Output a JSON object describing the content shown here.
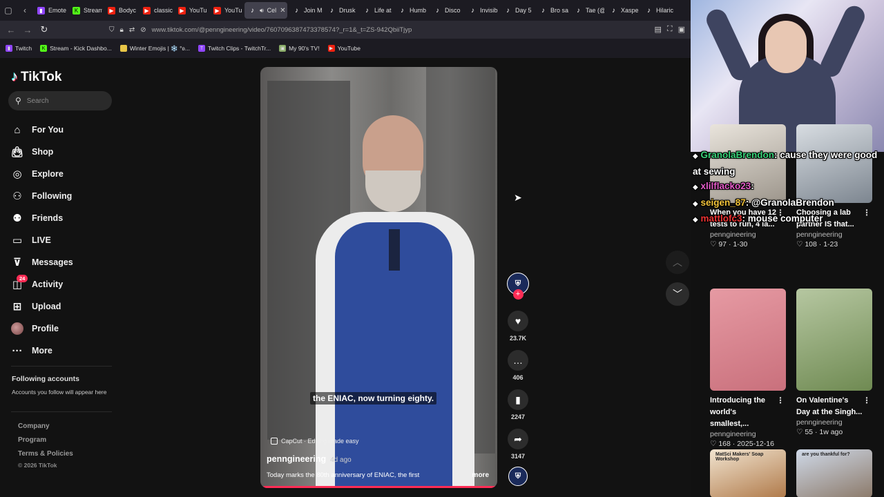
{
  "browser": {
    "tabs": [
      {
        "label": "Emote",
        "icon": "twitch"
      },
      {
        "label": "Stream",
        "icon": "kick"
      },
      {
        "label": "Bodyc",
        "icon": "youtube"
      },
      {
        "label": "classic",
        "icon": "youtube"
      },
      {
        "label": "YouTu",
        "icon": "youtube"
      },
      {
        "label": "YouTu",
        "icon": "youtube"
      },
      {
        "label": "Cel",
        "icon": "tiktok",
        "active": true
      },
      {
        "label": "Join M",
        "icon": "tiktok"
      },
      {
        "label": "Drusk",
        "icon": "tiktok"
      },
      {
        "label": "Life at",
        "icon": "tiktok"
      },
      {
        "label": "Humb",
        "icon": "tiktok"
      },
      {
        "label": "Disco",
        "icon": "tiktok"
      },
      {
        "label": "Invisib",
        "icon": "tiktok"
      },
      {
        "label": "Day 5",
        "icon": "tiktok"
      },
      {
        "label": "Bro sa",
        "icon": "tiktok"
      },
      {
        "label": "Tae (@",
        "icon": "tiktok"
      },
      {
        "label": "Xaspe",
        "icon": "tiktok"
      },
      {
        "label": "Hilaric",
        "icon": "tiktok"
      }
    ],
    "url": "www.tiktok.com/@penngineering/video/7607096387473378574?_r=1&_t=ZS-942QbiiTjyp",
    "bookmarks": [
      {
        "label": "Twitch",
        "icon": "twitch"
      },
      {
        "label": "Stream - Kick Dashbo...",
        "icon": "kick"
      },
      {
        "label": "Winter Emojis | ❄️ °ʚ...",
        "icon": "folder"
      },
      {
        "label": "Twitch Clips - TwitchTr...",
        "icon": "tt"
      },
      {
        "label": "My 90's TV!",
        "icon": "tv"
      },
      {
        "label": "YouTube",
        "icon": "youtube"
      }
    ]
  },
  "sidebar": {
    "logo": "TikTok",
    "search_placeholder": "Search",
    "items": [
      {
        "label": "For You",
        "icon": "home-icon"
      },
      {
        "label": "Shop",
        "icon": "shop-icon"
      },
      {
        "label": "Explore",
        "icon": "compass-icon"
      },
      {
        "label": "Following",
        "icon": "following-icon"
      },
      {
        "label": "Friends",
        "icon": "friends-icon"
      },
      {
        "label": "LIVE",
        "icon": "live-icon"
      },
      {
        "label": "Messages",
        "icon": "messages-icon"
      },
      {
        "label": "Activity",
        "icon": "activity-icon",
        "badge": "24"
      },
      {
        "label": "Upload",
        "icon": "upload-icon"
      },
      {
        "label": "Profile",
        "icon": "avatar"
      },
      {
        "label": "More",
        "icon": "more-icon"
      }
    ],
    "following_title": "Following accounts",
    "following_sub": "Accounts you follow will appear here",
    "footer": [
      "Company",
      "Program",
      "Terms & Policies"
    ],
    "copyright": "© 2026 TikTok"
  },
  "video": {
    "caption": "the ENIAC, now turning eighty.",
    "capcut": "CapCut · Editing made easy",
    "author": "penngineering",
    "ago": "4d ago",
    "description": "Today marks the 80th anniversary of ENIAC, the first",
    "more": "more",
    "progress": 0.99
  },
  "actions": {
    "likes": "23.7K",
    "comments": "406",
    "saves": "2247",
    "shares": "3147",
    "plus": "+"
  },
  "related": [
    {
      "title": "When you have 12 tests to run, 4 la...",
      "author": "penngineering",
      "likes": "97",
      "date": "1-30"
    },
    {
      "title": "Choosing a lab partner IS that...",
      "author": "penngineering",
      "likes": "108",
      "date": "1-23"
    },
    {
      "title": "Introducing the world's smallest,...",
      "author": "penngineering",
      "likes": "168",
      "date": "2025-12-16"
    },
    {
      "title": "On Valentine's Day at the Singh...",
      "author": "penngineering",
      "likes": "55",
      "date": "1w ago"
    },
    {
      "title": "MatSci Makers' Soap Workshop",
      "author": "",
      "likes": "",
      "date": ""
    },
    {
      "title": "are you thankful for?",
      "author": "",
      "likes": "",
      "date": ""
    }
  ],
  "chat": [
    {
      "user": "GranolaBrendon",
      "msg": ": cause they were good at sewing"
    },
    {
      "user": "xlilflacko23",
      "msg": ":"
    },
    {
      "user": "seigen_87",
      "msg": ": @GranolaBrendon"
    },
    {
      "user": "mattlofc3",
      "msg": ": mouse computer"
    }
  ],
  "colors": {
    "accent": "#fe2c55",
    "bg": "#121212",
    "teal": "#25f4ee"
  }
}
